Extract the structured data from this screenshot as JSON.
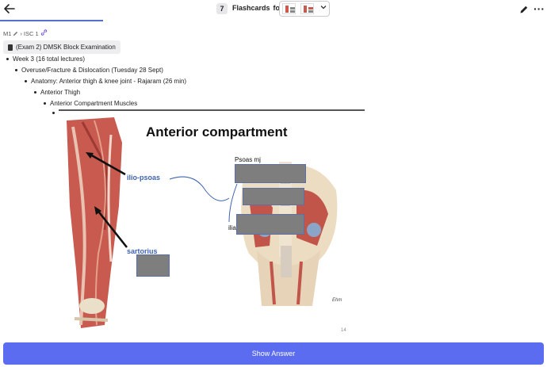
{
  "header": {
    "back_icon": "arrow-left-icon",
    "count": "7",
    "title": "Flashcards",
    "title_for": "for",
    "edit_icon": "pencil-icon",
    "more_icon": "more-horizontal-icon"
  },
  "breadcrumb": {
    "item1": "M1",
    "sep": "›",
    "item2": "ISC 1"
  },
  "deck": {
    "label": "(Exam 2) DMSK Block Examination"
  },
  "tree": {
    "l1": "Week 3 (16 total lectures)",
    "l2": "Overuse/Fracture & Dislocation (Tuesday 28 Sept)",
    "l3": "Anatomy: Anterior thigh & knee joint - Rajaram (26 min)",
    "l4": "Anterior Thigh",
    "l5": "Anterior Compartment Muscles"
  },
  "slide": {
    "title": "Anterior compartment",
    "label_iliopsoas": "ilio-psoas",
    "label_sartorius": "sartorius",
    "label_psoas": "Psoas mj",
    "label_ilia": "ilia",
    "signature": "Ehm",
    "page_number": "14"
  },
  "footer": {
    "show_answer": "Show Answer"
  },
  "colors": {
    "accent": "#5b6cf0",
    "label_blue": "#3f63b0",
    "mask_gray": "#7e7e7e"
  }
}
